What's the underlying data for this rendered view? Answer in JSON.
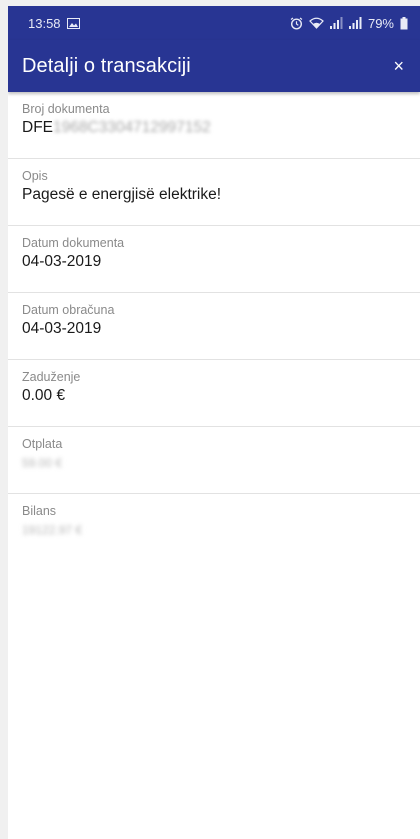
{
  "status_bar": {
    "time": "13:58",
    "battery": "79%"
  },
  "header": {
    "title": "Detalji o transakciji",
    "close_label": "×"
  },
  "fields": [
    {
      "label": "Broj dokumenta",
      "value_prefix": "DFE",
      "value_redacted": "1968C3304712997152"
    },
    {
      "label": "Opis",
      "value": "Pagesë e energjisë elektrike!"
    },
    {
      "label": "Datum dokumenta",
      "value": "04-03-2019"
    },
    {
      "label": "Datum obračuna",
      "value": "04-03-2019"
    },
    {
      "label": "Zaduženje",
      "value": "0.00 €"
    },
    {
      "label": "Otplata",
      "value_redacted": "59.00 €"
    },
    {
      "label": "Bilans",
      "value_redacted": "19122.97 €"
    }
  ],
  "colors": {
    "primary": "#283593",
    "divider": "#e2e2e2",
    "label": "#8a8a8a"
  }
}
